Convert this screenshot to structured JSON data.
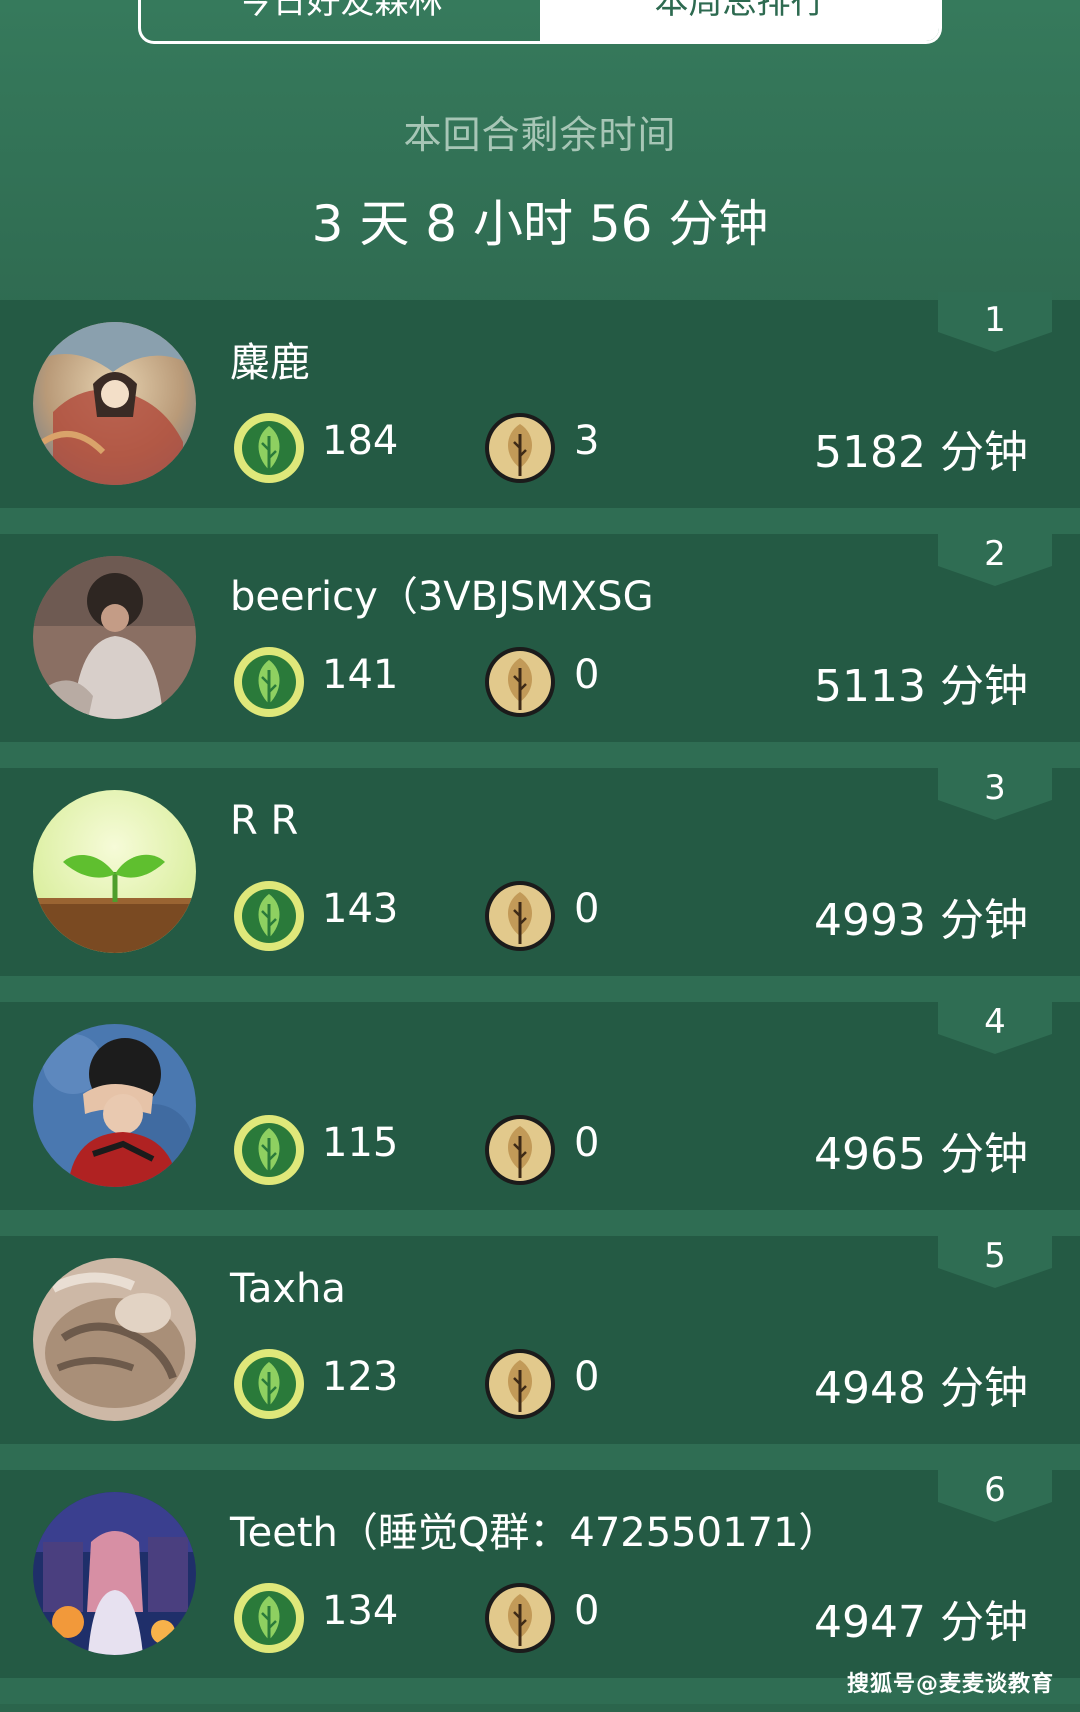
{
  "tabs": [
    {
      "label": "今日好友森林"
    },
    {
      "label": "本周总排行"
    }
  ],
  "remaining": {
    "label": "本回合剩余时间",
    "value": "3 天 8 小时 56 分钟"
  },
  "rows": [
    {
      "rank": "1",
      "name": "麋鹿",
      "trees": "184",
      "dead": "3",
      "minutes": "5182 分钟",
      "avatar": "anime-girl-avatar"
    },
    {
      "rank": "2",
      "name": "beericy（3VBJSMXSG",
      "trees": "141",
      "dead": "0",
      "minutes": "5113 分钟",
      "avatar": "person-photo-avatar"
    },
    {
      "rank": "3",
      "name": "R R",
      "trees": "143",
      "dead": "0",
      "minutes": "4993 分钟",
      "avatar": "sprout-avatar"
    },
    {
      "rank": "4",
      "name": "",
      "trees": "115",
      "dead": "0",
      "minutes": "4965 分钟",
      "avatar": "face-covered-avatar"
    },
    {
      "rank": "5",
      "name": "Taxha",
      "trees": "123",
      "dead": "0",
      "minutes": "4948 分钟",
      "avatar": "cat-avatar"
    },
    {
      "rank": "6",
      "name": "Teeth（睡觉Q群：472550171）",
      "trees": "134",
      "dead": "0",
      "minutes": "4947 分钟",
      "avatar": "anime-night-avatar"
    }
  ],
  "icons": {
    "live_tree": "leaf-coin-icon",
    "dead_tree": "dead-tree-coin-icon",
    "rank_badge": "rank-badge-icon"
  },
  "colors": {
    "background": "#2d6a50",
    "row": "#245a44",
    "tab_active_bg": "#ffffff",
    "label_muted": "#a7c6b6",
    "live_coin": "#dfe87a",
    "dead_coin": "#e2c98c"
  },
  "watermark": "搜狐号@麦麦谈教育"
}
